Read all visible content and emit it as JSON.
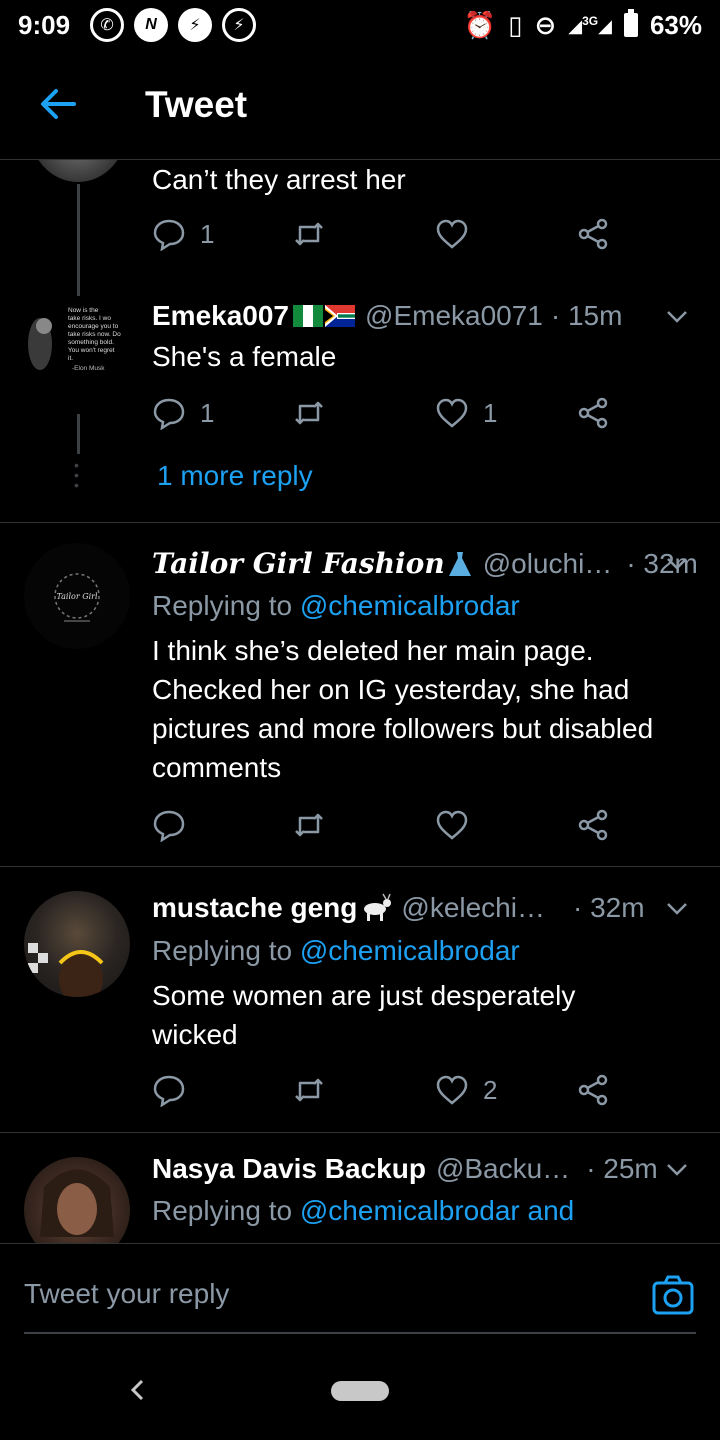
{
  "status_bar": {
    "time": "9:09",
    "left_icons": [
      "whatsapp-icon",
      "n-app-icon",
      "messenger-icon",
      "messenger-icon"
    ],
    "network": "3G",
    "battery": "63%"
  },
  "header": {
    "title": "Tweet",
    "back_icon": "back-arrow-icon"
  },
  "tweets": [
    {
      "body": "Can’t they arrest her",
      "reply_count": "1",
      "retweet_count": "",
      "like_count": ""
    },
    {
      "name": "Emeka007",
      "handle": "@Emeka0071",
      "time": "· 15m",
      "flags": [
        "nigeria-flag",
        "south-africa-flag"
      ],
      "avatar_text": "Now is the time to take risks. I would encourage you to take risks now. Do something bold. You won't regret it. -Elon Musk",
      "body": "She's a female",
      "reply_count": "1",
      "retweet_count": "",
      "like_count": "1",
      "more_replies": "1 more reply"
    },
    {
      "name": "Tailor Girl Fashion",
      "emoji": "dress-icon",
      "handle": "@oluchi…",
      "time": "· 32m",
      "avatar_text": "Tailor Girl",
      "replying_prefix": "Replying to ",
      "replying_to": "@chemicalbrodar",
      "body": "I think she’s deleted her main page. Checked her on IG yesterday, she had pictures and more followers but disabled comments",
      "reply_count": "",
      "retweet_count": "",
      "like_count": ""
    },
    {
      "name": "mustache geng",
      "emoji": "goat-icon",
      "handle": "@kelechi…",
      "time": "· 32m",
      "replying_prefix": "Replying to ",
      "replying_to": "@chemicalbrodar",
      "body": "Some women are just desperately wicked",
      "reply_count": "",
      "retweet_count": "",
      "like_count": "2"
    },
    {
      "name": "Nasya Davis Backup",
      "handle": "@Backu…",
      "time": "· 25m",
      "replying_prefix": "Replying to ",
      "replying_to": "@chemicalbrodar and"
    }
  ],
  "composer": {
    "placeholder": "Tweet your reply"
  },
  "colors": {
    "accent": "#1da1f2",
    "muted": "#8b98a5",
    "background": "#000000"
  }
}
